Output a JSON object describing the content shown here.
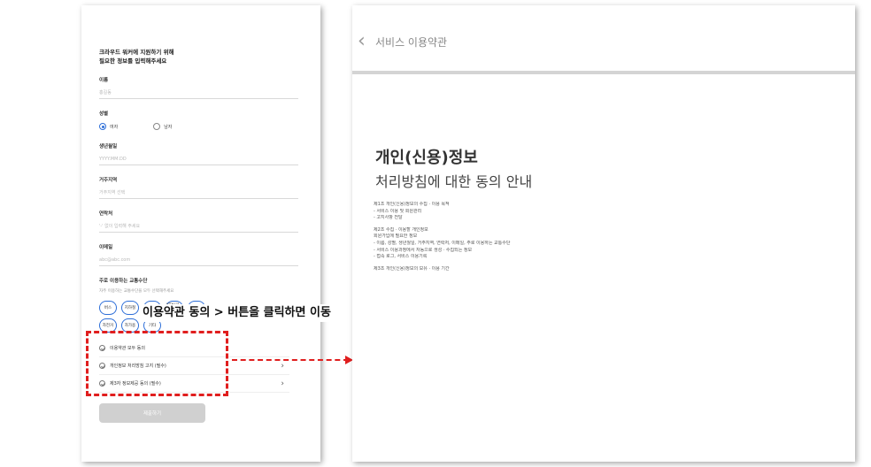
{
  "left_screen": {
    "heading_line1": "크라우드 워커에 지원하기 위해",
    "heading_line2": "필요한 정보를 입력해주세요",
    "fields": {
      "name": {
        "label": "이름",
        "placeholder": "홍길동"
      },
      "gender": {
        "label": "성별",
        "options": [
          "여자",
          "남자"
        ],
        "selected": "여자"
      },
      "birth": {
        "label": "생년월일",
        "placeholder": "YYYY.MM.DD"
      },
      "region": {
        "label": "거주지역",
        "placeholder": "거주지역 선택"
      },
      "phone": {
        "label": "연락처",
        "placeholder": "'-' 없이 입력해 주세요"
      },
      "email": {
        "label": "이메일",
        "placeholder": "abc@abc.com"
      }
    },
    "transport": {
      "label": "주로 이용하는 교통수단",
      "hint": "자주 이용하는 교통수단을 모두 선택해주세요",
      "chips": [
        "버스",
        "지하철",
        "택시",
        "KTX/기차",
        "도보",
        "자전거",
        "자가용",
        "기타"
      ]
    },
    "agreements": [
      {
        "label": "이용약관 모두 동의",
        "has_chevron": false
      },
      {
        "label": "개인정보 처리방침 고지 (필수)",
        "has_chevron": true
      },
      {
        "label": "제3자 정보제공 동의 (필수)",
        "has_chevron": true
      }
    ],
    "submit_label": "제출하기"
  },
  "annotation": {
    "callout": "이용약관 동의 > 버튼을 클릭하면 이동",
    "color": "#e01e1e"
  },
  "right_screen": {
    "back_glyph": "‹",
    "header_title": "서비스 이용약관",
    "doc_title": "개인(신용)정보",
    "doc_subtitle": "처리방침에 대한 동의 안내",
    "body_lines": [
      "",
      "제1조 개인(신용)정보의 수집 · 이용 목적",
      "- 서비스 이용 및 회원관리",
      "- 고지사항 전달",
      "",
      "제2조 수집 · 이용할 개인정보",
      "회원가입에 필요한 정보",
      "- 이름, 성별, 생년월일, 거주지역, 연락처, 이메일, 주로 이용하는 교통수단",
      "- 서비스 이용과정에서 자동으로 생성 · 수집되는 정보",
      "- 접속 로그, 서비스 이용기록",
      "",
      "제3조 개인(신용)정보의 보유 · 이용 기간",
      "",
      "",
      "",
      "",
      "",
      "",
      "",
      "",
      "",
      "",
      "",
      ""
    ]
  }
}
